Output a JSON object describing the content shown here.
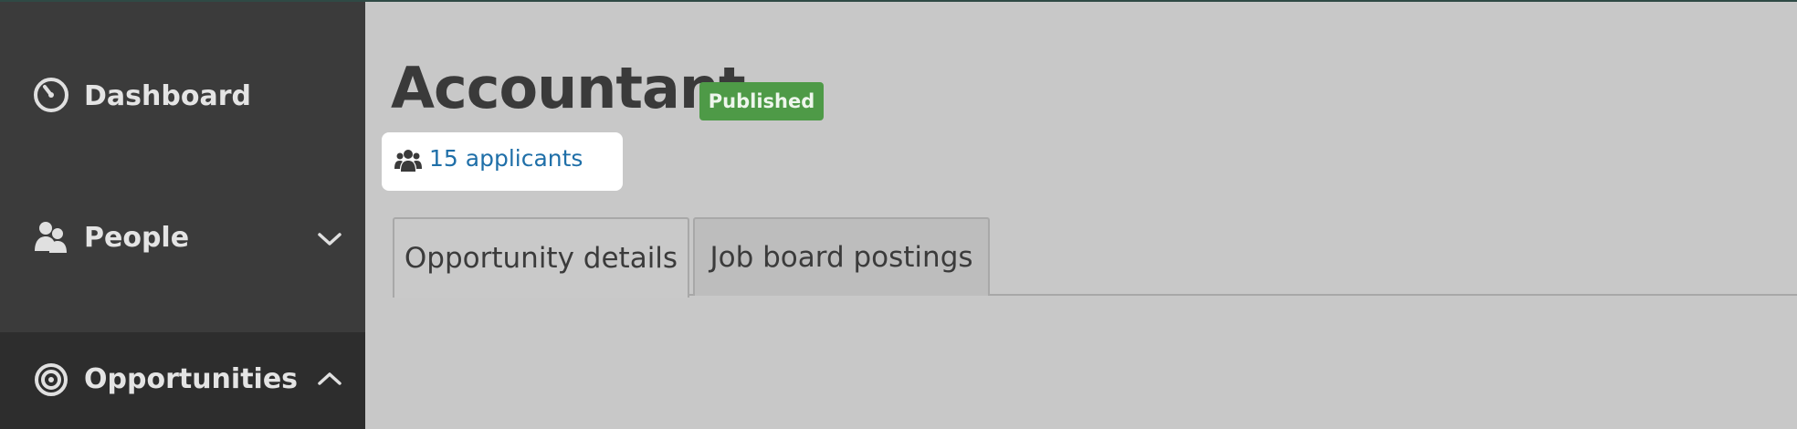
{
  "sidebar": {
    "items": [
      {
        "label": "Dashboard",
        "icon": "dashboard-gauge-icon"
      },
      {
        "label": "People",
        "icon": "people-icon",
        "chevron": "chevron-down-icon"
      },
      {
        "label": "Opportunities",
        "icon": "target-icon",
        "chevron": "chevron-up-icon",
        "active": true
      }
    ]
  },
  "main": {
    "title": "Accountant",
    "status_badge": "Published",
    "applicants_link": "15 applicants",
    "tabs": [
      {
        "label": "Opportunity details",
        "active": true
      },
      {
        "label": "Job board postings",
        "active": false
      }
    ]
  },
  "colors": {
    "sidebar_bg": "#3b3b3b",
    "sidebar_active_bg": "#2d2d2d",
    "main_bg": "#c8c8c8",
    "badge_green": "#4e9a47",
    "link_blue": "#1f6fa8"
  }
}
